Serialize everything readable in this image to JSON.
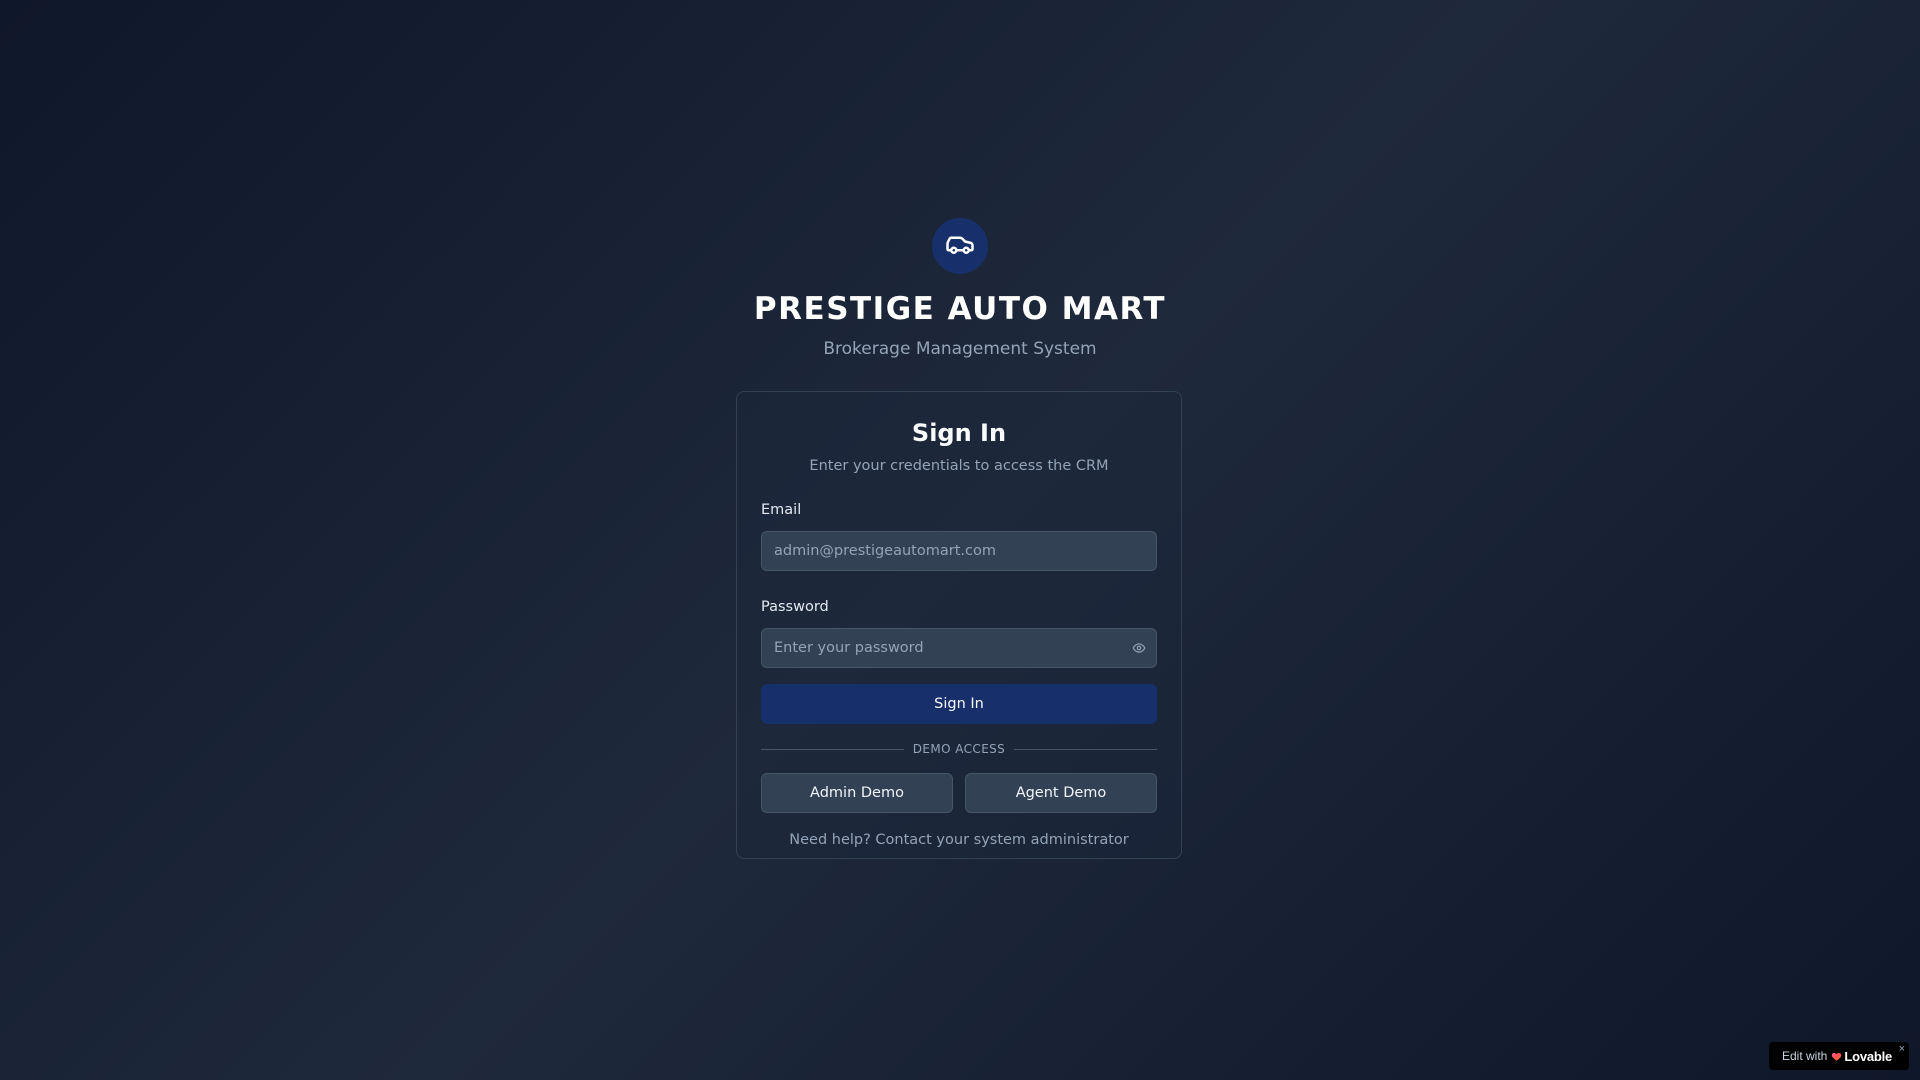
{
  "brand": {
    "logo_icon": "car-icon",
    "title": "PRESTIGE AUTO MART",
    "subtitle": "Brokerage Management System"
  },
  "signin_card": {
    "title": "Sign In",
    "description": "Enter your credentials to access the CRM",
    "email": {
      "label": "Email",
      "value": "",
      "placeholder": "admin@prestigeautomart.com"
    },
    "password": {
      "label": "Password",
      "value": "",
      "placeholder": "Enter your password",
      "toggle_icon": "eye-icon"
    },
    "submit_label": "Sign In",
    "divider_text": "DEMO ACCESS",
    "demo_buttons": [
      {
        "label": "Admin Demo"
      },
      {
        "label": "Agent Demo"
      }
    ],
    "help_text": "Need help? Contact your system administrator"
  },
  "badge": {
    "prefix": "Edit with",
    "brand": "Lovable",
    "close": "×"
  },
  "colors": {
    "background": "#0f172a",
    "accent": "#172f6b",
    "card_border": "#334155",
    "input_bg": "#334155",
    "muted_text": "#94a3b8"
  }
}
